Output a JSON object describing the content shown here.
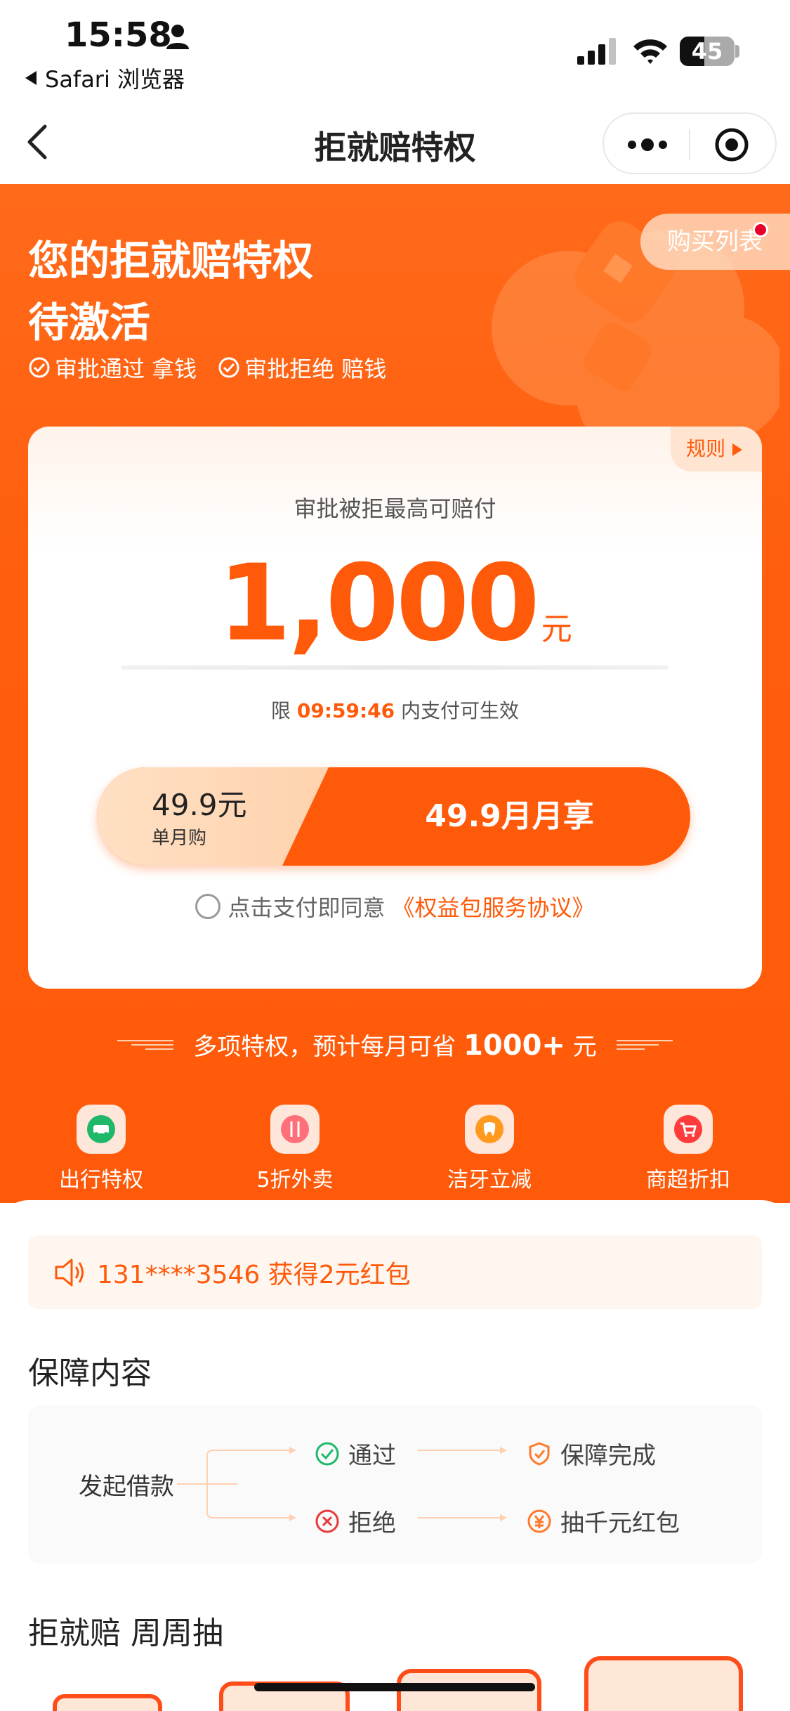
{
  "status_bar": {
    "time": "15:58",
    "back_app": "Safari 浏览器",
    "battery": "45",
    "battery_level": 0.45
  },
  "nav": {
    "title": "拒就赔特权"
  },
  "hero": {
    "title_line1": "您的拒就赔特权",
    "title_line2": "待激活",
    "benefit1": "审批通过 拿钱",
    "benefit2": "审批拒绝 赔钱",
    "buy_list": "购买列表"
  },
  "card": {
    "rule": "规则",
    "label": "审批被拒最高可赔付",
    "amount": "1,000",
    "unit": "元",
    "limit_prefix": "限",
    "timer": "09:59:46",
    "limit_suffix": "内支付可生效",
    "price": "49.9元",
    "price_desc": "单月购",
    "pay_label": "49.9月月享",
    "agree_text": "点击支付即同意",
    "agree_link": "《权益包服务协议》"
  },
  "privileges": {
    "title_prefix": "多项特权，预计每月可省",
    "title_amount": "1000+",
    "title_unit": "元",
    "items": [
      {
        "label": "出行特权",
        "icon": "car-icon",
        "color": "#1fb86a"
      },
      {
        "label": "5折外卖",
        "icon": "fork-knife-icon",
        "color": "#ff6f7a"
      },
      {
        "label": "洁牙立减",
        "icon": "tooth-icon",
        "color": "#ff9a1f"
      },
      {
        "label": "商超折扣",
        "icon": "cart-icon",
        "color": "#ff3b3b"
      }
    ]
  },
  "notice": {
    "text": "131****3546 获得2元红包"
  },
  "coverage": {
    "title": "保障内容",
    "start": "发起借款",
    "pass": "通过",
    "pass_result": "保障完成",
    "reject": "拒绝",
    "reject_result": "抽千元红包"
  },
  "weekly": {
    "title": "拒就赔 周周抽"
  },
  "colors": {
    "accent": "#ff5a0a",
    "hero": "#ff6a1a"
  }
}
